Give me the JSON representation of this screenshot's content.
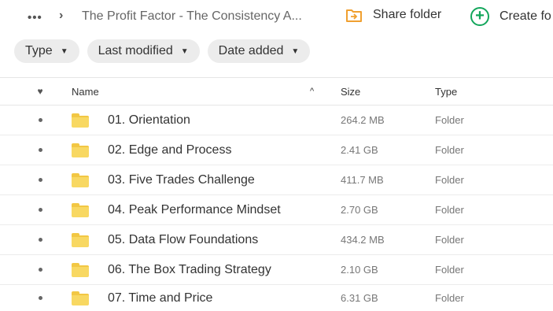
{
  "topbar": {
    "more_label": "•••",
    "chevron": "›",
    "breadcrumb": "The Profit Factor - The Consistency A...",
    "share_label": "Share folder",
    "create_label": "Create fo",
    "create_symbol": "+"
  },
  "filters": [
    {
      "label": "Type"
    },
    {
      "label": "Last modified"
    },
    {
      "label": "Date added"
    }
  ],
  "table": {
    "headers": {
      "favorite": "♥",
      "name": "Name",
      "name_sort": "^",
      "size": "Size",
      "type": "Type"
    },
    "rows": [
      {
        "name": "01. Orientation",
        "size": "264.2 MB",
        "type": "Folder"
      },
      {
        "name": "02. Edge and Process",
        "size": "2.41 GB",
        "type": "Folder"
      },
      {
        "name": "03. Five Trades Challenge",
        "size": "411.7 MB",
        "type": "Folder"
      },
      {
        "name": "04. Peak Performance Mindset",
        "size": "2.70 GB",
        "type": "Folder"
      },
      {
        "name": "05. Data Flow Foundations",
        "size": "434.2 MB",
        "type": "Folder"
      },
      {
        "name": "06. The Box Trading Strategy",
        "size": "2.10 GB",
        "type": "Folder"
      },
      {
        "name": "07. Time and Price",
        "size": "6.31 GB",
        "type": "Folder"
      }
    ]
  },
  "colors": {
    "accent_green": "#13a65b",
    "folder_yellow": "#f8d862",
    "share_orange": "#f0a030"
  }
}
